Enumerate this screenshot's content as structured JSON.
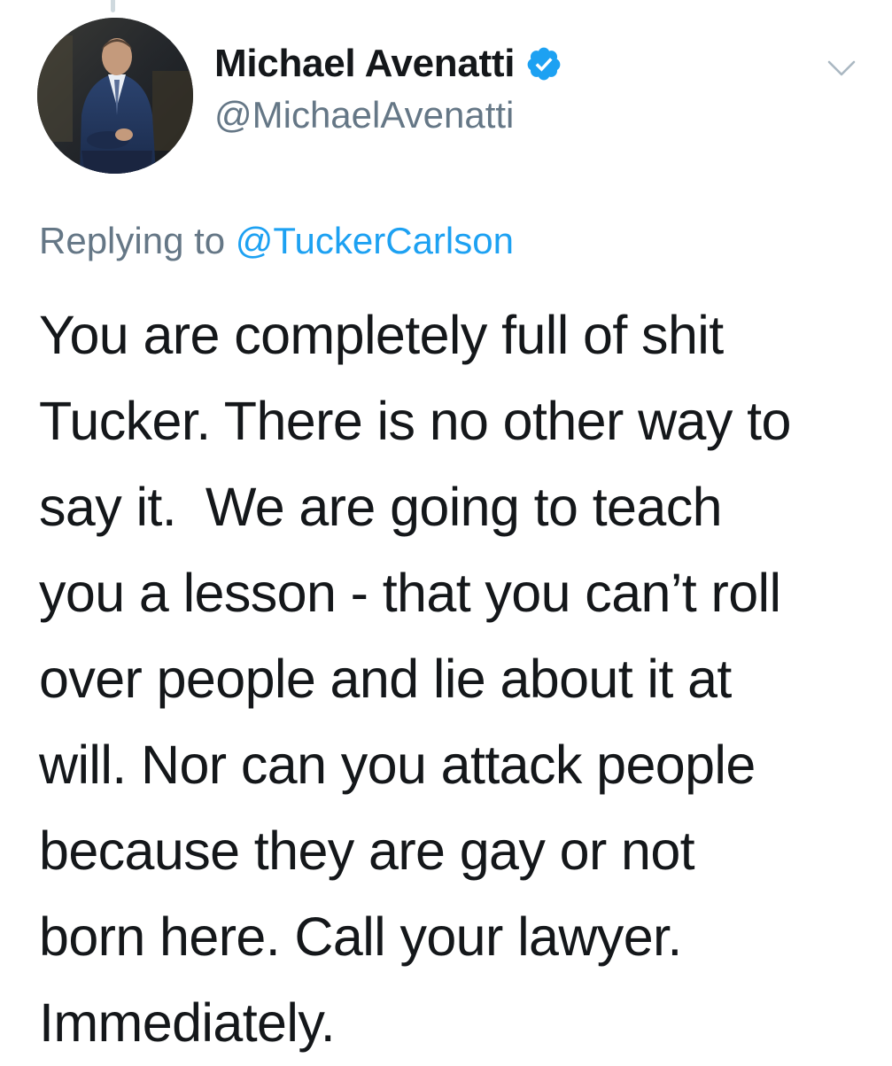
{
  "tweet": {
    "author": {
      "display_name": "Michael Avenatti",
      "handle": "@MichaelAvenatti",
      "verified": true,
      "avatar_icon": "profile-photo"
    },
    "reply": {
      "prefix": "Replying to",
      "mention": "@TuckerCarlson"
    },
    "text_lines": [
      "You are completely full of shit",
      "Tucker. There is no other way to",
      "say it.  We are going to teach",
      "you a lesson - that you can’t roll",
      "over people and lie about it at",
      "will. Nor can you attack people",
      "because they are gay or not",
      "born here. Call your lawyer.",
      "Immediately."
    ],
    "menu_icon": "chevron-down-icon",
    "verified_icon": "verified-badge-icon"
  },
  "colors": {
    "text": "#14171a",
    "secondary": "#657786",
    "link": "#1da1f2",
    "verified": "#1da1f2"
  }
}
